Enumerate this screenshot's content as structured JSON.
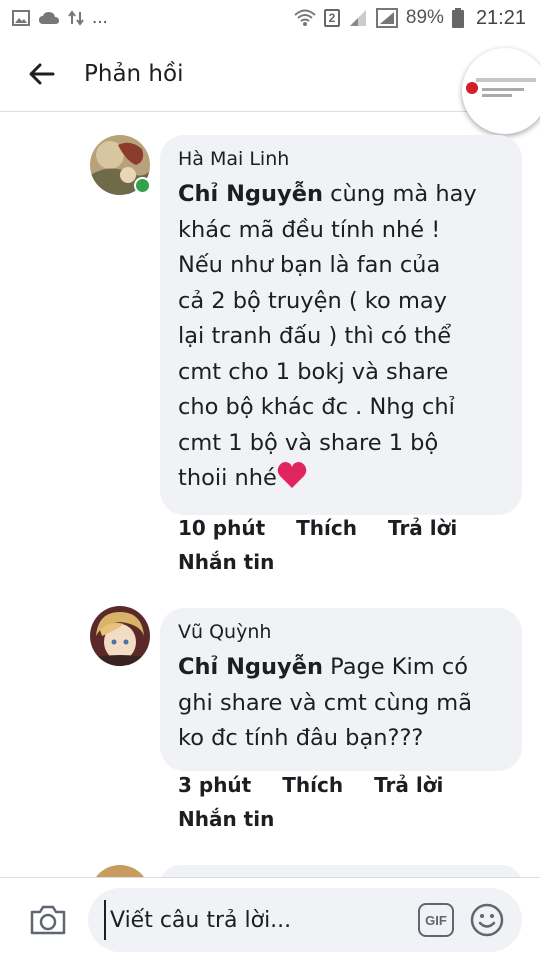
{
  "status_bar": {
    "battery": "89%",
    "time": "21:21",
    "sim": "2",
    "dots": "..."
  },
  "header": {
    "title": "Phản hồi"
  },
  "comments": [
    {
      "author": "Hà Mai Linh",
      "mention": "Chỉ Nguyễn",
      "text_lines": [
        " cùng mà hay",
        "khác mã đều tính nhé !",
        "Nếu như bạn là fan của",
        "cả 2 bộ truyện ( ko may",
        "lại tranh đấu ) thì có thể",
        "cmt cho 1 bokj và share",
        "cho bộ khác đc . Nhg chỉ",
        "cmt 1 bộ và share 1 bộ",
        "thoii nhé"
      ],
      "emoji": "red-heart",
      "time": "10 phút",
      "like_label": "Thích",
      "reply_label": "Trả lời",
      "message_label": "Nhắn tin"
    },
    {
      "author": "Vũ Quỳnh",
      "mention": "Chỉ Nguyễn",
      "text_lines": [
        " Page Kim có",
        "ghi share và cmt cùng mã",
        "ko đc tính đâu bạn???"
      ],
      "time": "3 phút",
      "like_label": "Thích",
      "reply_label": "Trả lời",
      "message_label": "Nhắn tin"
    }
  ],
  "composer": {
    "placeholder": "Viết câu trả lời...",
    "gif_label": "GIF"
  },
  "colors": {
    "bubble": "#f0f2f5",
    "online": "#31a24c",
    "heart": "#e0245e"
  }
}
